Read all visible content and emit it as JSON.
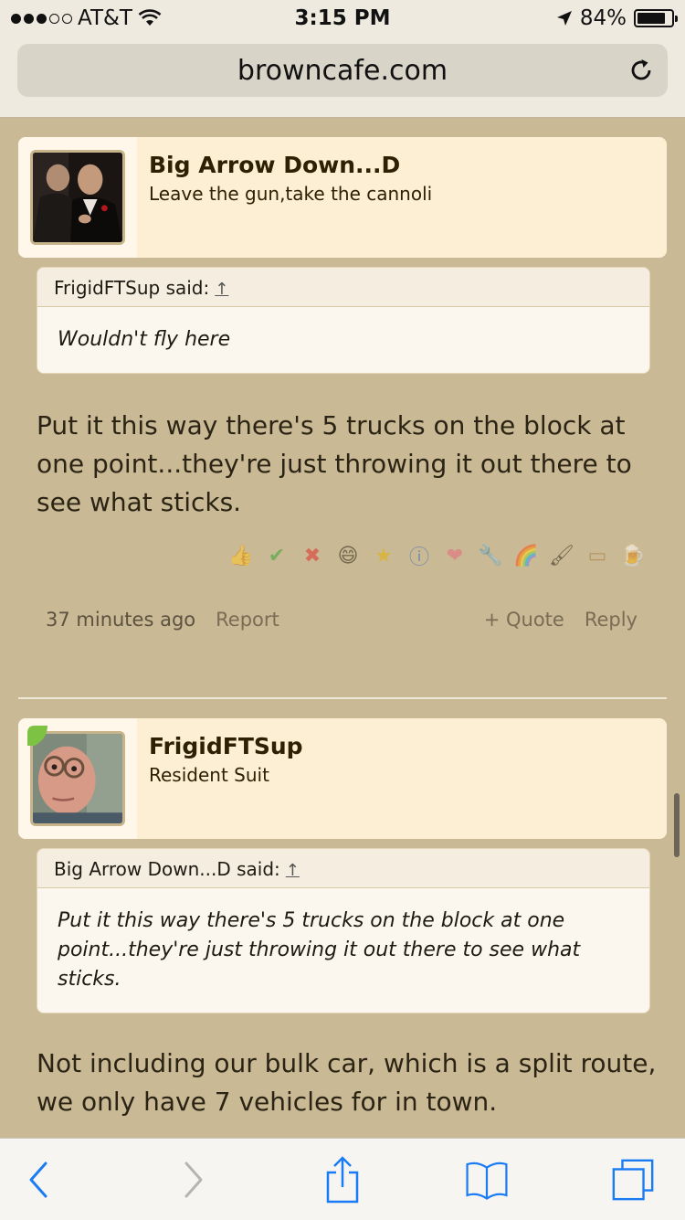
{
  "status_bar": {
    "carrier": "AT&T",
    "time": "3:15 PM",
    "battery": "84%",
    "battery_level": 0.84
  },
  "browser": {
    "url": "browncafe.com"
  },
  "posts": [
    {
      "username": "Big Arrow Down...D",
      "user_title": "Leave the gun,take the cannoli",
      "quote": {
        "author_label": "FrigidFTSup said:",
        "arrow": "↑",
        "text": "Wouldn't fly here"
      },
      "body": "Put it this way there's 5 trucks on the block at one point...they're just throwing it out there to see what sticks.",
      "timestamp": "37 minutes ago",
      "report_label": "Report",
      "quote_label": "+ Quote",
      "reply_label": "Reply"
    },
    {
      "username": "FrigidFTSup",
      "user_title": "Resident Suit",
      "quote": {
        "author_label": "Big Arrow Down...D said:",
        "arrow": "↑",
        "text": "Put it this way there's 5 trucks on the block at one point...they're just throwing it out there to see what sticks."
      },
      "body": "Not including our bulk car, which is a split route, we only have 7 vehicles for in town."
    }
  ],
  "reaction_icons": [
    "thumbs-up-icon",
    "checkmark-icon",
    "x-icon",
    "laugh-icon",
    "award-icon",
    "info-icon",
    "heart-icon",
    "wrench-icon",
    "rainbow-icon",
    "paintbrush-icon",
    "wallet-icon",
    "beer-icon"
  ],
  "colors": {
    "page_bg": "#c9b995",
    "card_bg": "#fcefd4",
    "ios_blue": "#1a7cf5",
    "online_green": "#7dc242"
  }
}
